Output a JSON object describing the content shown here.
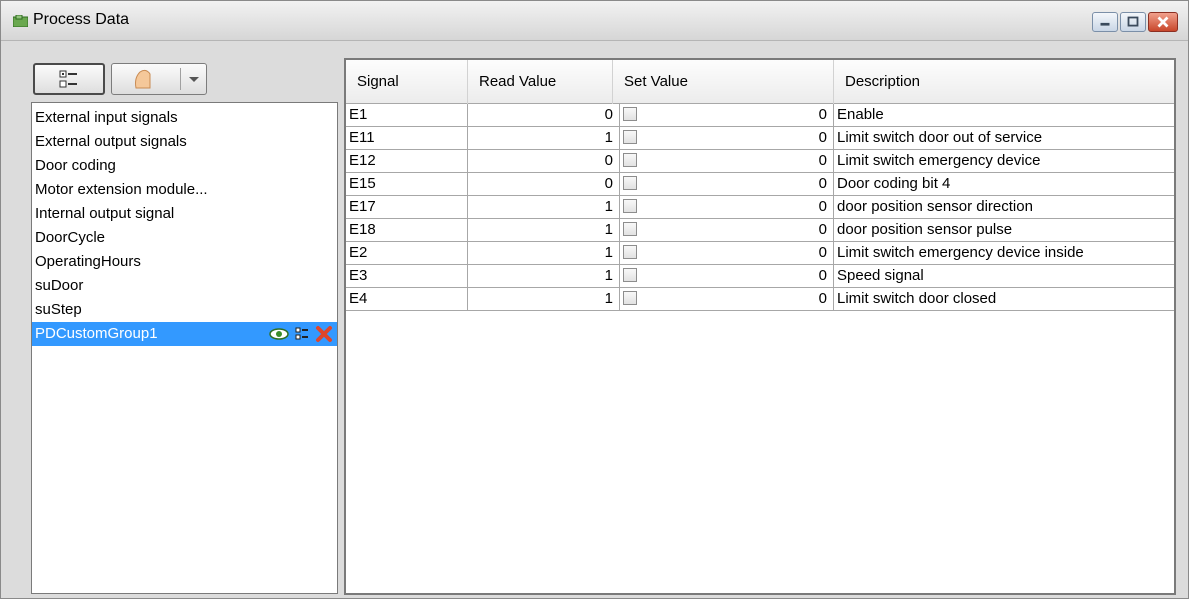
{
  "window": {
    "title": "Process Data"
  },
  "left_panel": {
    "items": [
      {
        "label": "External input signals"
      },
      {
        "label": "External output signals"
      },
      {
        "label": "Door coding"
      },
      {
        "label": "Motor extension module..."
      },
      {
        "label": "Internal output signal"
      },
      {
        "label": "DoorCycle"
      },
      {
        "label": "OperatingHours"
      },
      {
        "label": "suDoor"
      },
      {
        "label": "suStep"
      },
      {
        "label": "PDCustomGroup1",
        "selected": true
      }
    ]
  },
  "table": {
    "columns": [
      "Signal",
      "Read Value",
      "Set Value",
      "Description"
    ],
    "rows": [
      {
        "signal": "E1",
        "read": "0",
        "set": "0",
        "description": "Enable"
      },
      {
        "signal": "E11",
        "read": "1",
        "set": "0",
        "description": "Limit switch door out of service"
      },
      {
        "signal": "E12",
        "read": "0",
        "set": "0",
        "description": "Limit switch emergency device"
      },
      {
        "signal": "E15",
        "read": "0",
        "set": "0",
        "description": "Door coding bit 4"
      },
      {
        "signal": "E17",
        "read": "1",
        "set": "0",
        "description": "door position sensor direction"
      },
      {
        "signal": "E18",
        "read": "1",
        "set": "0",
        "description": "door position sensor pulse"
      },
      {
        "signal": "E2",
        "read": "1",
        "set": "0",
        "description": "Limit switch emergency device inside"
      },
      {
        "signal": "E3",
        "read": "1",
        "set": "0",
        "description": "Speed signal"
      },
      {
        "signal": "E4",
        "read": "1",
        "set": "0",
        "description": "Limit switch door closed"
      }
    ]
  },
  "colors": {
    "selection": "#3399ff",
    "close_button": "#c8472b"
  }
}
